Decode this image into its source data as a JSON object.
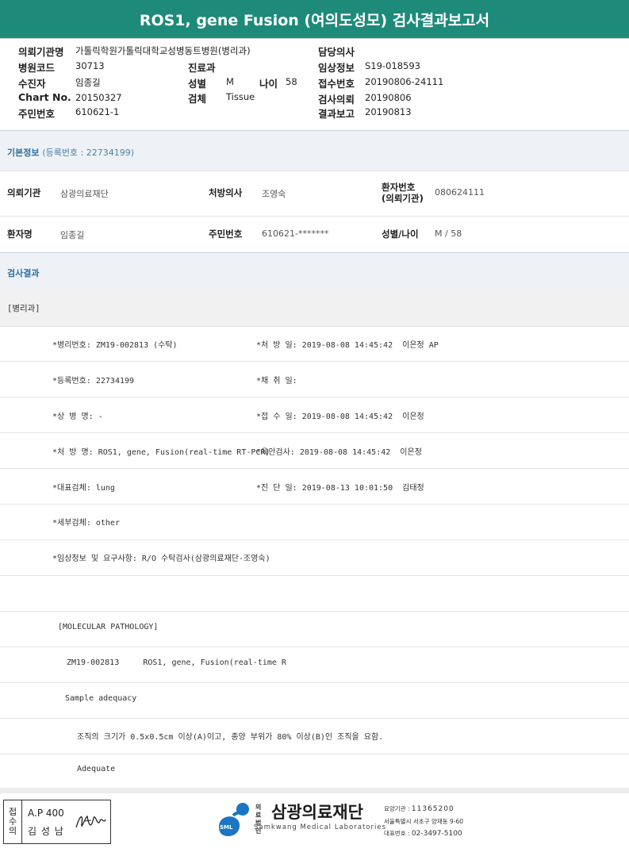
{
  "title": "ROS1, gene Fusion (여의도성모) 검사결과보고서",
  "header": {
    "institution_label": "의뢰기관명",
    "institution_value": "가톨릭학원가톨릭대학교성병동트병원(병리과)",
    "doctor_label": "담당의사",
    "doctor_value": "",
    "hospital_code_label": "병원코드",
    "hospital_code_value": "30713",
    "dept_label": "진료과",
    "dept_value": "",
    "clinical_info_label": "임상정보",
    "clinical_info_value": "S19-018593",
    "receiver_label": "수진자",
    "receiver_value": "임종길",
    "sex_label": "성별",
    "sex_value": "M",
    "age_label": "나이",
    "age_value": "58",
    "receipt_no_label": "접수번호",
    "receipt_no_value": "20190806-24111",
    "chart_label": "Chart No.",
    "chart_value": "20150327",
    "specimen_label": "검체",
    "specimen_value": "Tissue",
    "test_request_label": "검사의뢰",
    "test_request_value": "20190806",
    "resident_label": "주민번호",
    "resident_value": "610621-1",
    "result_report_label": "결과보고",
    "result_report_value": "20190813"
  },
  "basic_info": {
    "section_title": "기본정보",
    "reg_no": "(등록번호 : 22734199)",
    "institution_label": "의뢰기관",
    "institution_value": "삼광의료재단",
    "prescriber_label": "처방의사",
    "prescriber_value": "조영숙",
    "patient_no_label_1": "환자번호",
    "patient_no_label_2": "(의뢰기관)",
    "patient_no_value": "080624111",
    "patient_name_label": "환자명",
    "patient_name_value": "임종길",
    "resident_label": "주민번호",
    "resident_value": "610621-*******",
    "sex_age_label": "성별/나이",
    "sex_age_value": "M / 58"
  },
  "result": {
    "section_title": "검사결과",
    "dept": "[병리과]",
    "rows": [
      {
        "left": "*병리번호: ZM19-002813 (수탁)",
        "right": "*처 방 일: 2019-08-08 14:45:42  이은정 AP"
      },
      {
        "left": "*등록번호: 22734199",
        "right": "*채 취 일:"
      },
      {
        "left": "*상 병 명: -",
        "right": "*접 수 일: 2019-08-08 14:45:42  이은정"
      },
      {
        "left": "*처 방 명: ROS1, gene, Fusion(real-time RT-PCR)",
        "right": "*육안검사: 2019-08-08 14:45:42  이은정"
      },
      {
        "left": "*대표검체: lung",
        "right": "*진 단 일: 2019-08-13 10:01:50  김태정"
      },
      {
        "left": "*세부검체: other",
        "right": ""
      },
      {
        "left": "*임상정보 및 요구사항: R/O 수탁검사(삼광의료재단-조영숙)",
        "right": ""
      }
    ],
    "molecular_title": "[MOLECULAR PATHOLOGY]",
    "molecular_line": "ZM19-002813     ROS1, gene, Fusion(real-time R",
    "adequacy_title": "Sample adequacy",
    "adequacy_desc": "조직의 크기가 0.5x0.5cm 이상(A)이고, 종양 부위가 80% 이상(B)인 조직을 요함.",
    "adequacy_value": "Adequate"
  },
  "footer": {
    "stamp_chars": [
      "접",
      "수",
      "의"
    ],
    "stamp_code": "A.P 400",
    "stamp_name": "김 성 남",
    "logo_small_1": "의료",
    "logo_small_2": "법인",
    "logo_name": "삼광의료재단",
    "logo_en": "Samkwang Medical Laboratories",
    "logo_badge": "SML",
    "care_org_label": "요양기관",
    "care_org_value": "11365200",
    "address": "서울특별시 서초구 양재동 9-60",
    "tel_label": "대표번호",
    "tel_value": "02-3497-5100",
    "colors": {
      "accent": "#1e8a7a",
      "logo_blue": "#1a76c2"
    }
  }
}
